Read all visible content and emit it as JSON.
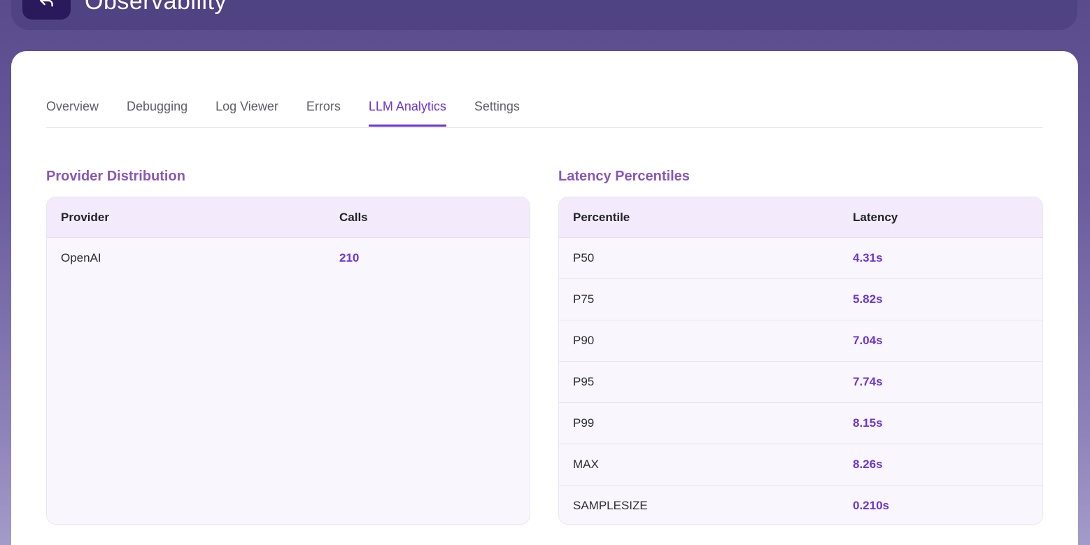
{
  "header": {
    "title": "Observability",
    "back_icon": "back-arrow-icon"
  },
  "tabs": [
    {
      "label": "Overview",
      "active": false
    },
    {
      "label": "Debugging",
      "active": false
    },
    {
      "label": "Log Viewer",
      "active": false
    },
    {
      "label": "Errors",
      "active": false
    },
    {
      "label": "LLM Analytics",
      "active": true
    },
    {
      "label": "Settings",
      "active": false
    }
  ],
  "provider_distribution": {
    "title": "Provider Distribution",
    "columns": [
      "Provider",
      "Calls"
    ],
    "rows": [
      {
        "provider": "OpenAI",
        "calls": "210"
      }
    ]
  },
  "latency_percentiles": {
    "title": "Latency Percentiles",
    "columns": [
      "Percentile",
      "Latency"
    ],
    "rows": [
      {
        "percentile": "P50",
        "latency": "4.31s"
      },
      {
        "percentile": "P75",
        "latency": "5.82s"
      },
      {
        "percentile": "P90",
        "latency": "7.04s"
      },
      {
        "percentile": "P95",
        "latency": "7.74s"
      },
      {
        "percentile": "P99",
        "latency": "8.15s"
      },
      {
        "percentile": "MAX",
        "latency": "8.26s"
      },
      {
        "percentile": "SAMPLESIZE",
        "latency": "0.210s"
      }
    ]
  },
  "colors": {
    "accent": "#6d34d6",
    "section_title": "#8a56b8",
    "header_bg": "#4f4383",
    "back_button_bg": "#2a1a5c"
  }
}
